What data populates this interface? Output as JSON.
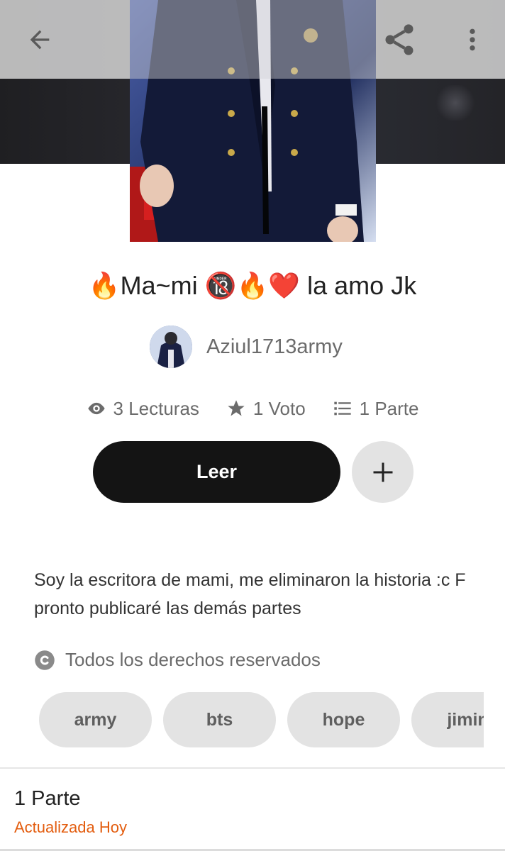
{
  "toolbar": {
    "back_icon": "arrow-left-icon",
    "share_icon": "share-icon",
    "more_icon": "more-vertical-icon"
  },
  "story": {
    "title": "🔥Ma~mi 🔞🔥❤️ la amo Jk",
    "author": "Aziul1713army",
    "stats": {
      "reads": "3 Lecturas",
      "votes": "1 Voto",
      "parts": "1 Parte"
    },
    "description": "Soy la escritora de mami, me eliminaron la historia :c F pronto publicaré las demás partes",
    "copyright": "Todos los derechos reservados"
  },
  "actions": {
    "read_label": "Leer",
    "add_icon": "plus-icon"
  },
  "tags": [
    "army",
    "bts",
    "hope",
    "jimin"
  ],
  "parts_section": {
    "title": "1 Parte",
    "updated": "Actualizada Hoy"
  },
  "colors": {
    "accent": "#e35d0f",
    "read_button": "#141414",
    "chip": "#e3e3e3",
    "text_secondary": "#6b6b6b"
  }
}
